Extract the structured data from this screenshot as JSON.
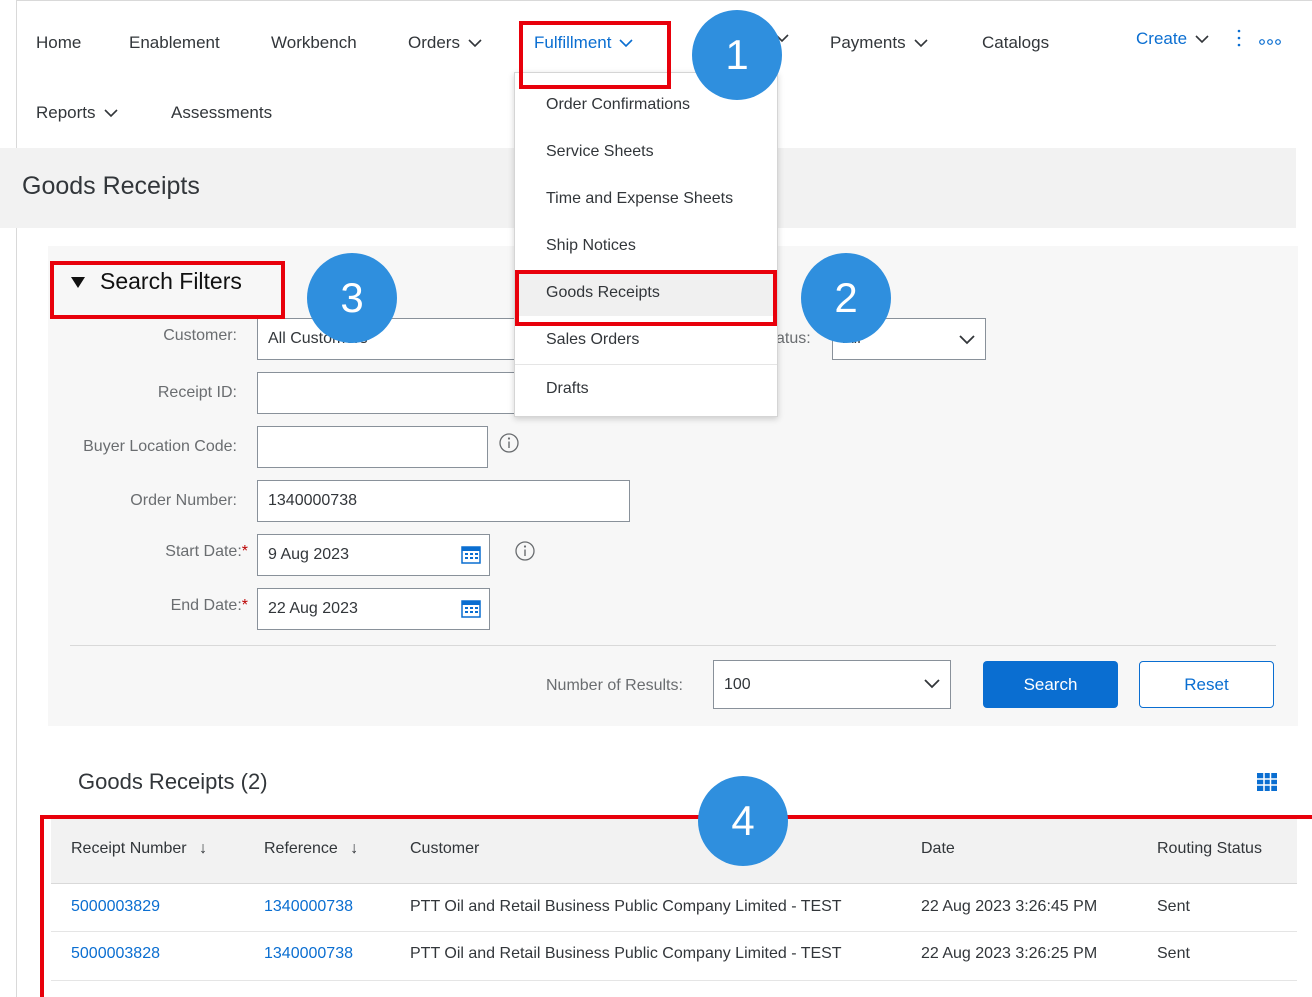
{
  "nav": {
    "home": "Home",
    "enablement": "Enablement",
    "workbench": "Workbench",
    "orders": "Orders",
    "fulfillment": "Fulfillment",
    "payments": "Payments",
    "catalogs": "Catalogs",
    "create": "Create",
    "reports": "Reports",
    "assessments": "Assessments"
  },
  "fulfillment_menu": {
    "items": [
      "Order Confirmations",
      "Service Sheets",
      "Time and Expense Sheets",
      "Ship Notices",
      "Goods Receipts",
      "Sales Orders",
      "Drafts"
    ],
    "highlighted": "Goods Receipts"
  },
  "page": {
    "title": "Goods Receipts"
  },
  "filters": {
    "toggle_label": "Search Filters",
    "customer_label": "Customer:",
    "customer_value": "All Customers",
    "status_label": "Status:",
    "status_value": "All",
    "receipt_id_label": "Receipt ID:",
    "receipt_id_value": "",
    "buyer_location_label": "Buyer Location Code:",
    "buyer_location_value": "",
    "order_number_label": "Order Number:",
    "order_number_value": "1340000738",
    "start_date_label": "Start Date:",
    "start_date_value": "9 Aug 2023",
    "end_date_label": "End Date:",
    "end_date_value": "22 Aug 2023",
    "required_mark": "*",
    "results_label": "Number of Results:",
    "results_value": "100",
    "search_button": "Search",
    "reset_button": "Reset"
  },
  "results": {
    "title": "Goods Receipts (2)",
    "columns": [
      "Receipt Number",
      "Reference",
      "Customer",
      "Date",
      "Routing Status"
    ],
    "rows": [
      {
        "receipt": "5000003829",
        "reference": "1340000738",
        "customer": "PTT Oil and Retail Business Public Company Limited - TEST",
        "date": "22 Aug 2023 3:26:45 PM",
        "status": "Sent"
      },
      {
        "receipt": "5000003828",
        "reference": "1340000738",
        "customer": "PTT Oil and Retail Business Public Company Limited - TEST",
        "date": "22 Aug 2023 3:26:25 PM",
        "status": "Sent"
      }
    ]
  },
  "callouts": [
    "1",
    "2",
    "3",
    "4"
  ],
  "colors": {
    "accent": "#0a6ed1",
    "callout": "#2f8fde",
    "highlight_box": "#e8000b"
  }
}
